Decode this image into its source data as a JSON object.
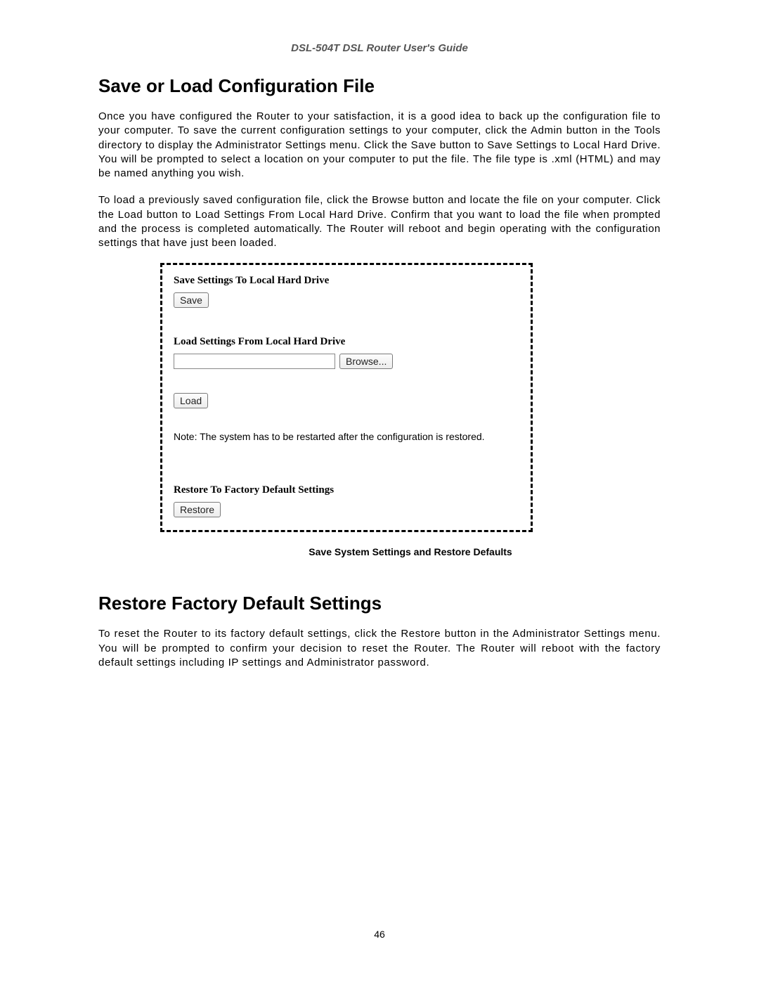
{
  "header": "DSL-504T DSL Router User's Guide",
  "section1": {
    "heading": "Save or Load Configuration File",
    "para1": "Once you have configured the Router to your satisfaction, it is a good idea to back up the configuration file to your computer. To save the current configuration settings to your computer, click the Admin button in the Tools directory to display the Administrator Settings menu. Click the Save button to Save Settings to Local Hard Drive. You will be prompted to select a location on your computer to put the file. The file type is .xml (HTML) and may be named anything you wish.",
    "para2": "To load a previously saved configuration file, click the Browse button and locate the file on your computer. Click the Load button to Load Settings From Local Hard Drive. Confirm that you want to load the file when prompted and the process is completed automatically. The Router will reboot and begin operating with the configuration settings that have just been loaded."
  },
  "figure": {
    "saveHeading": "Save Settings To Local Hard Drive",
    "saveButton": "Save",
    "loadHeading": "Load Settings From Local Hard Drive",
    "browseButton": "Browse...",
    "loadButton": "Load",
    "note": "Note: The system has to be restarted after the configuration is restored.",
    "restoreHeading": "Restore To Factory Default Settings",
    "restoreButton": "Restore",
    "caption": "Save System Settings and Restore Defaults"
  },
  "section2": {
    "heading": "Restore Factory Default Settings",
    "para1": "To reset the Router to its factory default settings, click the Restore button in the Administrator Settings menu. You will be prompted to confirm your decision to reset the Router. The Router will reboot with the factory default settings including IP settings and Administrator password."
  },
  "pageNumber": "46"
}
